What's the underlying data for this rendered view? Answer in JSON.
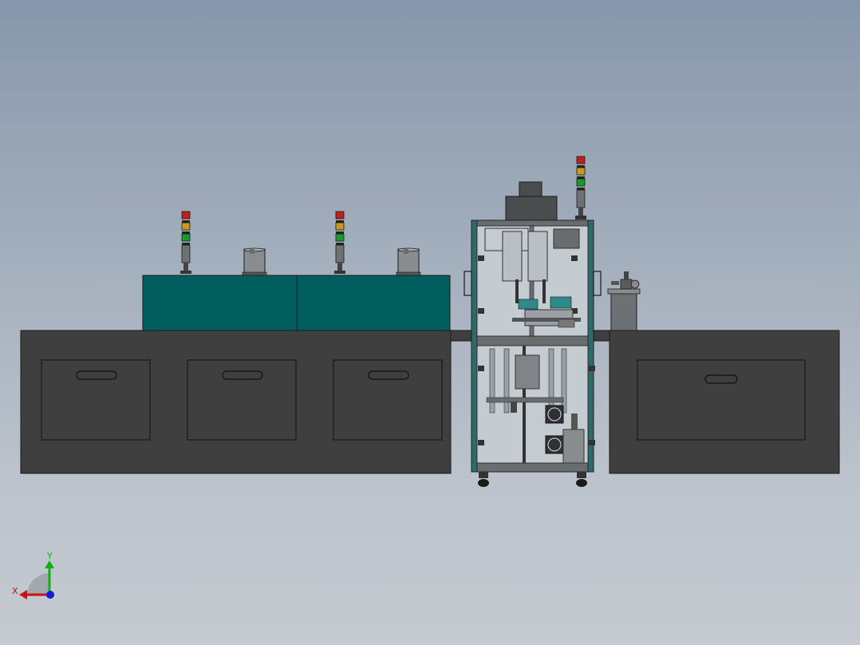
{
  "viewport": {
    "background_top": "#8797ab",
    "background_bottom": "#c5cad0"
  },
  "colors": {
    "body_dark": "#3f3f3f",
    "panel_teal": "#005e5e",
    "frame_gray": "#606366",
    "glass": "#c4cbd1",
    "outline": "#1a1a1a",
    "light_red": "#c0201a",
    "light_amber": "#c89a1a",
    "light_green": "#1a9a2a",
    "axis_x": "#d01010",
    "axis_y": "#10b010",
    "axis_z": "#1020d0"
  },
  "triad": {
    "x_label": "X",
    "y_label": "Y"
  }
}
